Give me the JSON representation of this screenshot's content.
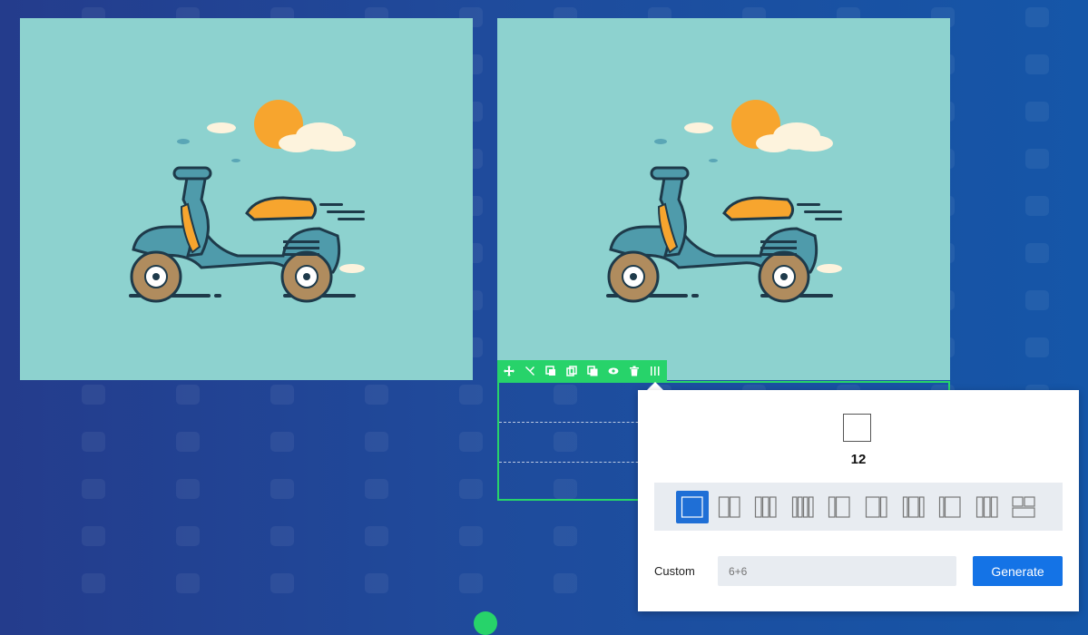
{
  "toolbar": {
    "icons": [
      "move-icon",
      "tools-icon",
      "copy-icon",
      "duplicate-icon",
      "paste-icon",
      "visibility-icon",
      "trash-icon",
      "columns-icon"
    ]
  },
  "popup": {
    "preview_value": "12",
    "layouts": [
      "12",
      "6+6",
      "4+4+4",
      "3+3+3+3",
      "4+8",
      "8+4",
      "3+6+3",
      "2+10",
      "custom-grid",
      "2x2"
    ],
    "active_layout_index": 0,
    "custom_label": "Custom",
    "custom_placeholder": "6+6",
    "generate_label": "Generate"
  },
  "colors": {
    "accent_green": "#27d36a",
    "primary_blue": "#1473e6",
    "image_bg": "#8dd2cf"
  }
}
